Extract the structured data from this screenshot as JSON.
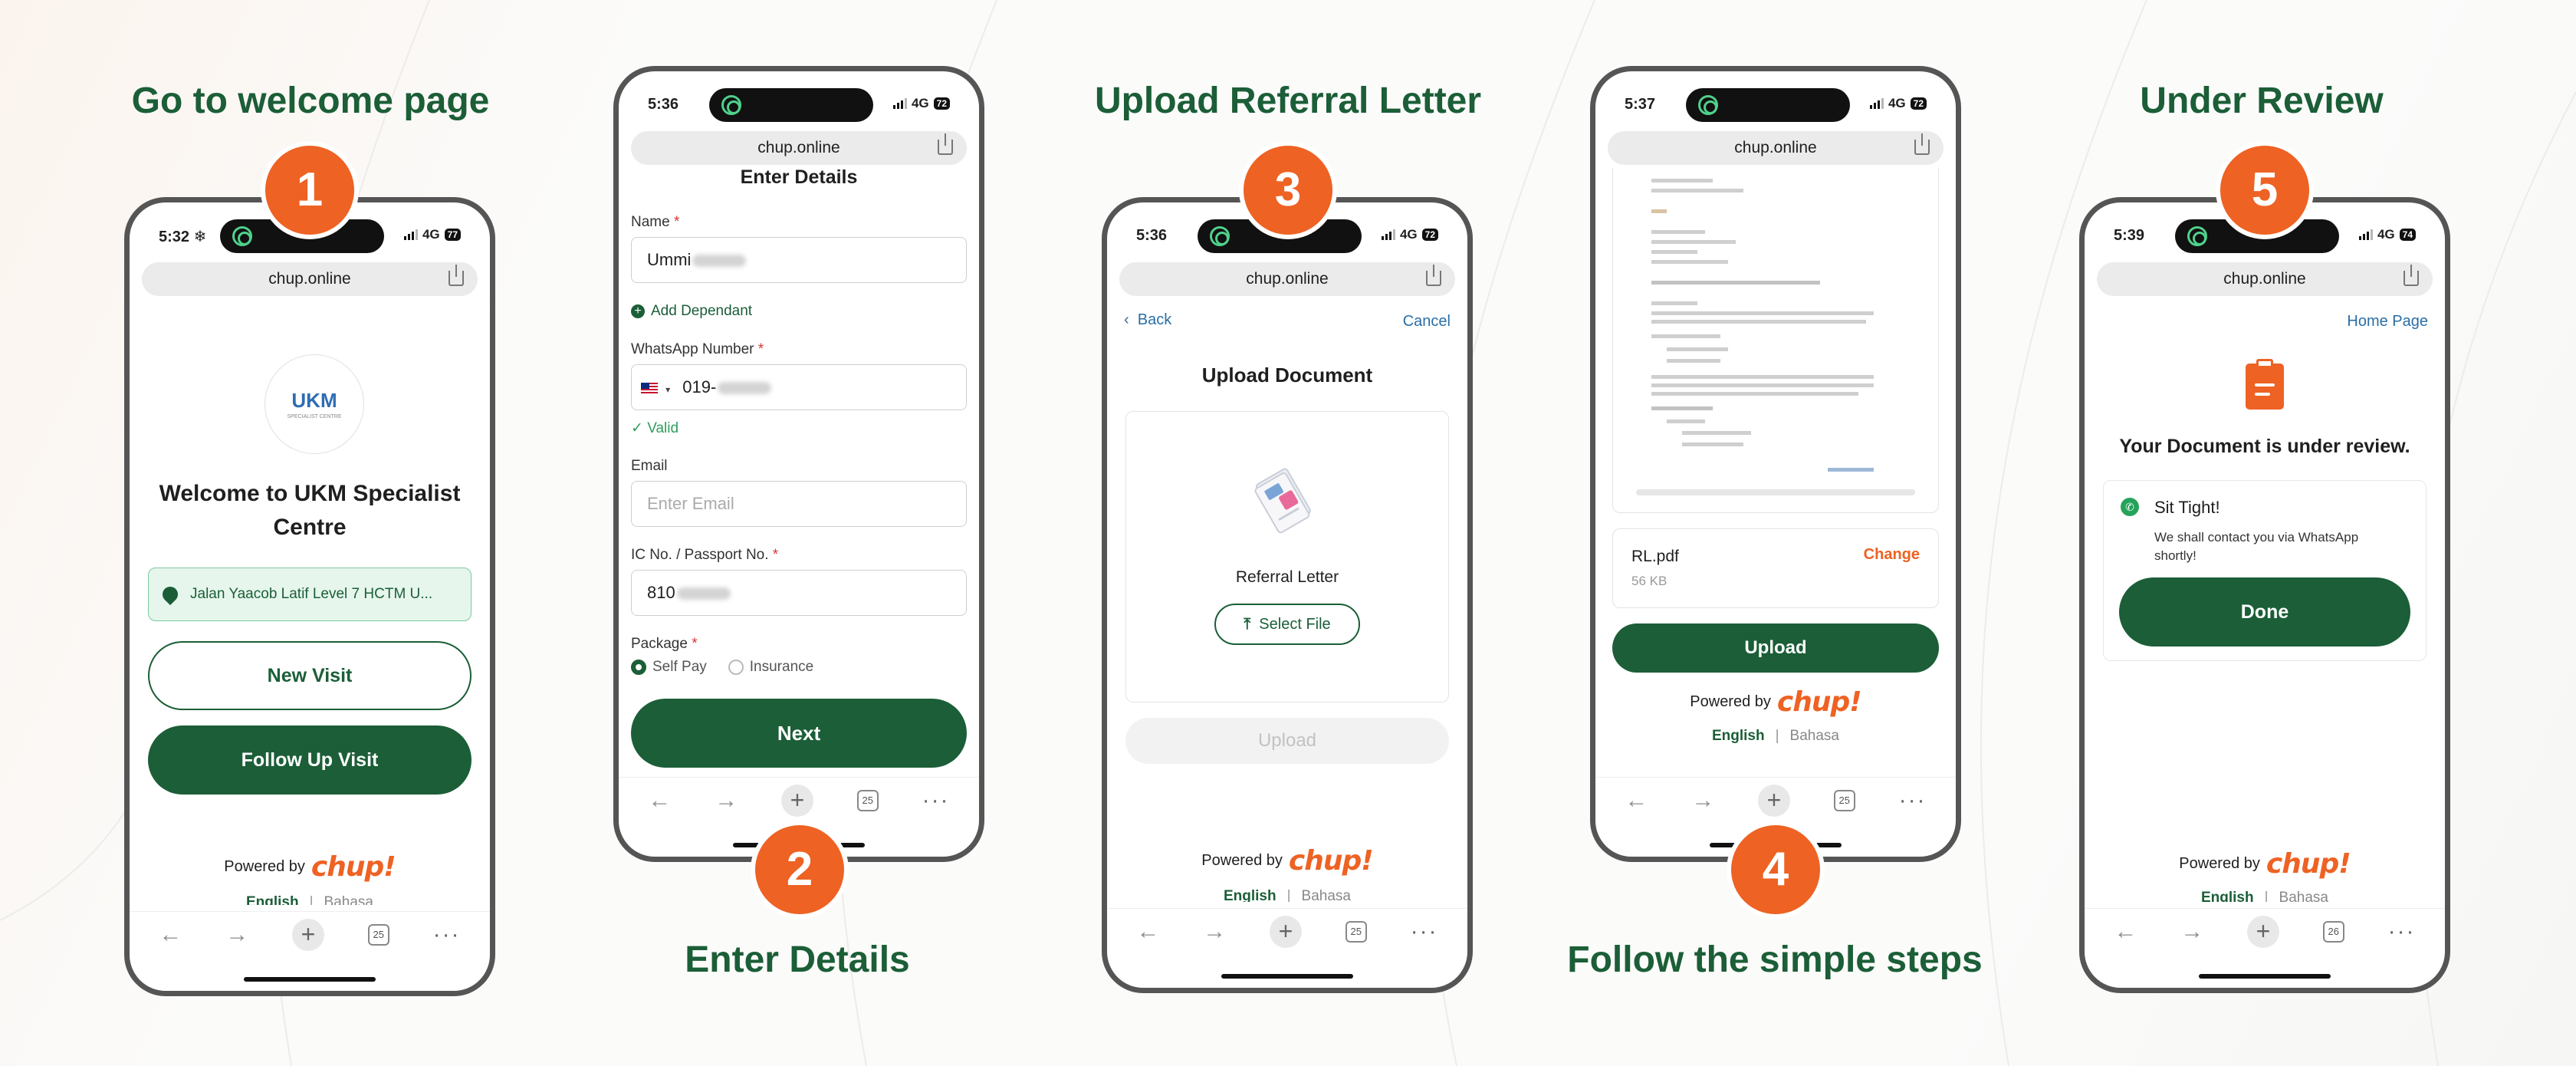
{
  "steps": [
    {
      "num": "1",
      "title": "Go to welcome page"
    },
    {
      "num": "2",
      "title": "Enter Details"
    },
    {
      "num": "3",
      "title": "Upload Referral Letter"
    },
    {
      "num": "4",
      "title": "Follow the simple steps"
    },
    {
      "num": "5",
      "title": "Under Review"
    }
  ],
  "browser": {
    "url": "chup.online",
    "network": "4G"
  },
  "phone1": {
    "time": "5:32 ❄",
    "battery": "77",
    "tabs": "25",
    "logo_text": "UKM",
    "logo_sub": "SPECIALIST CENTRE",
    "welcome": "Welcome to UKM Specialist Centre",
    "location": "Jalan Yaacob Latif Level 7 HCTM U...",
    "new_visit": "New Visit",
    "follow_up": "Follow Up Visit"
  },
  "phone2": {
    "time": "5:36",
    "battery": "72",
    "tabs": "25",
    "heading": "Enter Details",
    "name_label": "Name",
    "name_value": "Ummi",
    "add_dependant": "Add Dependant",
    "whatsapp_label": "WhatsApp Number",
    "whatsapp_value": "019-",
    "valid": "✓ Valid",
    "email_label": "Email",
    "email_placeholder": "Enter Email",
    "ic_label": "IC No. / Passport No.",
    "ic_value": "810",
    "package_label": "Package",
    "opt_self": "Self Pay",
    "opt_insurance": "Insurance",
    "next": "Next"
  },
  "phone3": {
    "time": "5:36",
    "battery": "72",
    "tabs": "25",
    "back": "Back",
    "cancel": "Cancel",
    "heading": "Upload Document",
    "doc_label": "Referral Letter",
    "select_file": "Select File",
    "upload": "Upload"
  },
  "phone4": {
    "time": "5:37",
    "battery": "72",
    "tabs": "25",
    "file_name": "RL.pdf",
    "file_size": "56 KB",
    "change": "Change",
    "upload": "Upload"
  },
  "phone5": {
    "time": "5:39",
    "battery": "74",
    "tabs": "26",
    "home": "Home Page",
    "status": "Your Document is under review.",
    "card_title": "Sit Tight!",
    "card_body": "We shall contact you via WhatsApp shortly!",
    "done": "Done"
  },
  "footer": {
    "powered": "Powered by",
    "brand": "chup!",
    "english": "English",
    "sep": "|",
    "bahasa": "Bahasa"
  },
  "colors": {
    "brand_green": "#1b5e37",
    "accent_orange": "#ee6223"
  }
}
